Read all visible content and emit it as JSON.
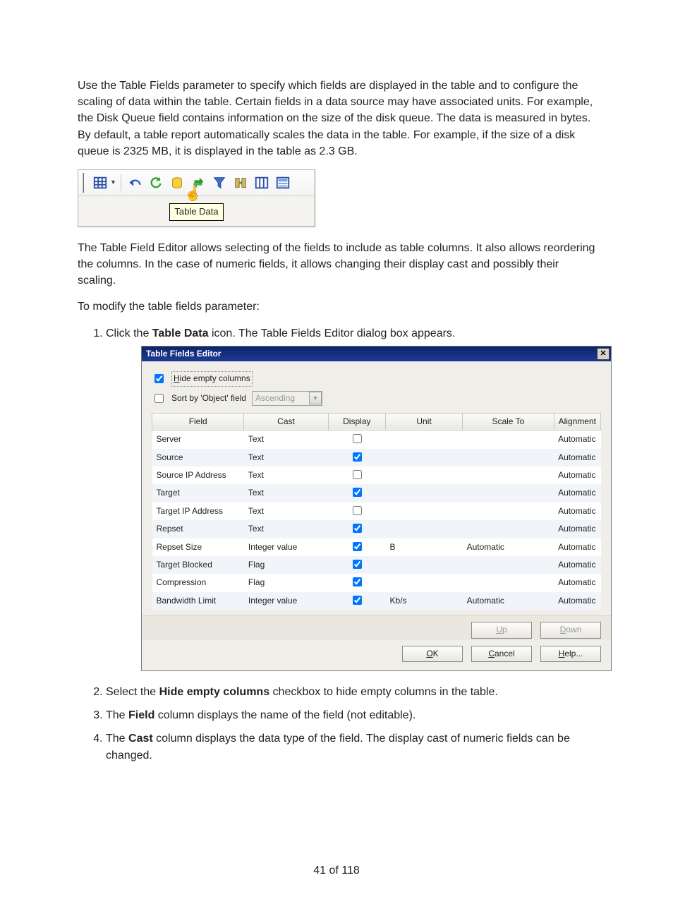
{
  "paragraphs": {
    "p1": "Use the Table Fields parameter to specify which fields are displayed in the table and to configure the scaling of data within the table. Certain fields in a data source may have associated units. For example, the Disk Queue field contains information on the size of the disk queue. The data is measured in bytes. By default, a table report automatically scales the data in the table. For example, if the size of a disk queue is 2325 MB, it is displayed in the table as 2.3 GB.",
    "p2": "The Table Field Editor allows selecting of the fields to include as table columns. It also allows reordering the columns. In the case of numeric fields, it allows changing their display cast and possibly their scaling.",
    "p3": "To modify the table fields parameter:"
  },
  "toolbar": {
    "tooltip": "Table Data"
  },
  "steps": {
    "s1_a": "Click the ",
    "s1_b": "Table Data",
    "s1_c": " icon. The Table Fields Editor dialog box appears.",
    "s2_a": "Select the ",
    "s2_b": "Hide empty columns",
    "s2_c": " checkbox to hide empty columns in the table.",
    "s3_a": "The ",
    "s3_b": "Field",
    "s3_c": " column displays the name of the field (not editable).",
    "s4_a": "The ",
    "s4_b": "Cast",
    "s4_c": " column displays the data type of the field. The display cast of numeric fields can be changed."
  },
  "dialog": {
    "title": "Table Fields Editor",
    "hide_empty_label": "Hide empty columns",
    "hide_empty_checked": true,
    "sort_by_label": "Sort by 'Object' field",
    "sort_by_checked": false,
    "sort_dir": "Ascending",
    "headers": {
      "field": "Field",
      "cast": "Cast",
      "display": "Display",
      "unit": "Unit",
      "scale_to": "Scale To",
      "alignment": "Alignment"
    },
    "rows": [
      {
        "field": "Server",
        "cast": "Text",
        "display": false,
        "unit": "",
        "scale": "",
        "align": "Automatic"
      },
      {
        "field": "Source",
        "cast": "Text",
        "display": true,
        "unit": "",
        "scale": "",
        "align": "Automatic"
      },
      {
        "field": "Source IP Address",
        "cast": "Text",
        "display": false,
        "unit": "",
        "scale": "",
        "align": "Automatic"
      },
      {
        "field": "Target",
        "cast": "Text",
        "display": true,
        "unit": "",
        "scale": "",
        "align": "Automatic"
      },
      {
        "field": "Target IP Address",
        "cast": "Text",
        "display": false,
        "unit": "",
        "scale": "",
        "align": "Automatic"
      },
      {
        "field": "Repset",
        "cast": "Text",
        "display": true,
        "unit": "",
        "scale": "",
        "align": "Automatic"
      },
      {
        "field": "Repset Size",
        "cast": "Integer value",
        "display": true,
        "unit": "B",
        "scale": "Automatic",
        "align": "Automatic"
      },
      {
        "field": "Target Blocked",
        "cast": "Flag",
        "display": true,
        "unit": "",
        "scale": "",
        "align": "Automatic"
      },
      {
        "field": "Compression",
        "cast": "Flag",
        "display": true,
        "unit": "",
        "scale": "",
        "align": "Automatic"
      },
      {
        "field": "Bandwidth Limit",
        "cast": "Integer value",
        "display": true,
        "unit": "Kb/s",
        "scale": "Automatic",
        "align": "Automatic"
      }
    ],
    "buttons": {
      "up": "Up",
      "down": "Down",
      "ok": "OK",
      "cancel": "Cancel",
      "help": "Help..."
    }
  },
  "footer": {
    "page": "41 of 118"
  }
}
